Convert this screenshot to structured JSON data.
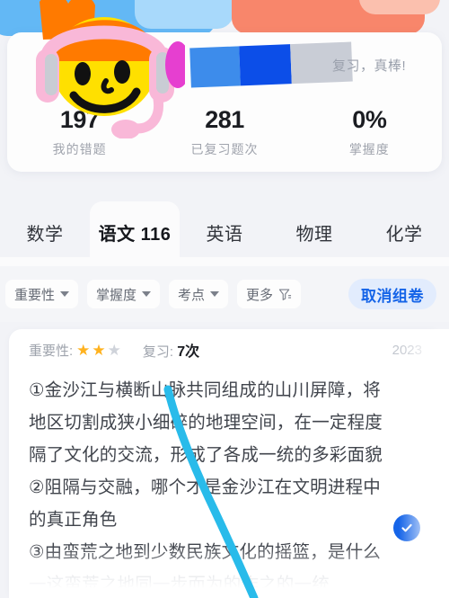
{
  "summary": {
    "progress": {
      "segments": [
        {
          "name": "segment-light-blue",
          "color": "#3d8ceb",
          "width_pct": 31
        },
        {
          "name": "segment-dark-blue",
          "color": "#0c4ee8",
          "width_pct": 32
        },
        {
          "name": "segment-gray",
          "color": "#c9cdd6",
          "width_pct": 37
        }
      ],
      "note": "复习，真棒!"
    },
    "stats": [
      {
        "value": "197",
        "label": "我的错题"
      },
      {
        "value": "281",
        "label": "已复习题次"
      },
      {
        "value": "0%",
        "label": "掌握度"
      }
    ]
  },
  "tabs": [
    {
      "label": "数学",
      "active": false
    },
    {
      "label": "语文 116",
      "active": true
    },
    {
      "label": "英语",
      "active": false
    },
    {
      "label": "物理",
      "active": false
    },
    {
      "label": "化学",
      "active": false
    }
  ],
  "filters": {
    "chips": [
      {
        "label": "重要性",
        "icon": "chevron-down-icon"
      },
      {
        "label": "掌握度",
        "icon": "chevron-down-icon"
      },
      {
        "label": "考点",
        "icon": "chevron-down-icon"
      },
      {
        "label": "更多",
        "icon": "filter-funnel-icon"
      }
    ],
    "cancel_label": "取消组卷",
    "cancel_color": "#1564e8",
    "cancel_bg": "#e2ecfd"
  },
  "question_card": {
    "importance_label": "重要性:",
    "stars_filled": 2,
    "stars_total": 3,
    "review_label": "复习:",
    "review_count": "7次",
    "date": "2023",
    "lines": [
      "①金沙江与横断山脉共同组成的山川屏障，将",
      "地区切割成狭小细碎的地理空间，在一定程度",
      "隔了文化的交流，形成了各成一统的多彩面貌",
      "②阻隔与交融，哪个才是金沙江在文明进程中",
      "的真正角色",
      "③由蛮荒之地到少数民族文化的摇篮，是什么",
      "一这蛮荒之地同一步而为的作之的一统"
    ],
    "check_icon": "check-circle-icon",
    "check_color": "#1564e8"
  },
  "annotation": {
    "name": "cyan-pen-stroke",
    "color": "#29bbea"
  },
  "decor": {
    "cards": [
      {
        "name": "deco-card-blue",
        "color": "#63b8f5"
      },
      {
        "name": "deco-card-blue2",
        "color": "#a8d9fb"
      },
      {
        "name": "deco-card-coral",
        "color": "#f8866b"
      },
      {
        "name": "deco-card-coral2",
        "color": "#fbc0ae"
      }
    ],
    "sticker": "smiley-with-headphones-sticker"
  }
}
